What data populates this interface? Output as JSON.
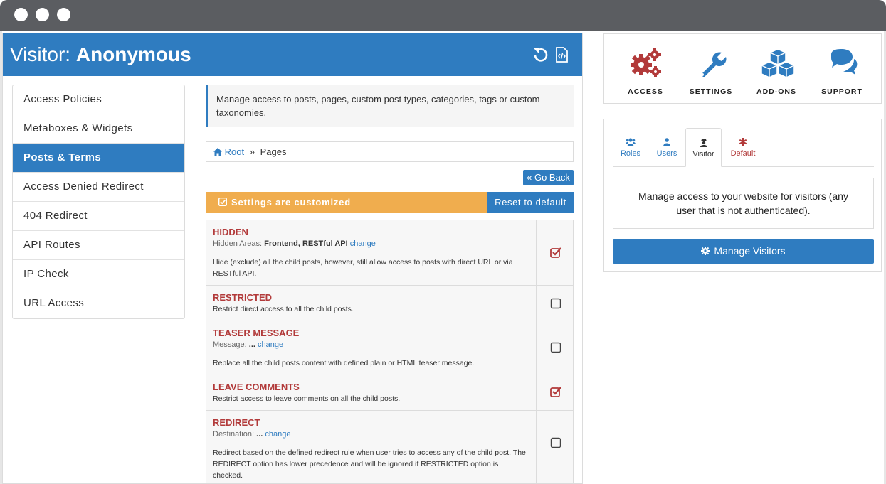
{
  "header": {
    "prefix": "Visitor:",
    "name": "Anonymous"
  },
  "nav": {
    "items": [
      {
        "label": "Access Policies"
      },
      {
        "label": "Metaboxes & Widgets"
      },
      {
        "label": "Posts & Terms",
        "active": true
      },
      {
        "label": "Access Denied Redirect"
      },
      {
        "label": "404 Redirect"
      },
      {
        "label": "API Routes"
      },
      {
        "label": "IP Check"
      },
      {
        "label": "URL Access"
      }
    ]
  },
  "content": {
    "info": "Manage access to posts, pages, custom post types, categories, tags or custom taxonomies.",
    "breadcrumb": {
      "root": "Root",
      "separator": "»",
      "current": "Pages"
    },
    "go_back": "« Go Back",
    "status": "Settings are customized",
    "reset": "Reset to default",
    "options": [
      {
        "title": "HIDDEN",
        "meta_label": "Hidden Areas:",
        "meta_value": "Frontend, RESTful API",
        "change": "change",
        "desc": "Hide (exclude) all the child posts, however, still allow access to posts with direct URL or via RESTful API.",
        "checked": true
      },
      {
        "title": "RESTRICTED",
        "desc": "Restrict direct access to all the child posts.",
        "checked": false
      },
      {
        "title": "TEASER MESSAGE",
        "meta_label": "Message:",
        "meta_value": "...",
        "change": "change",
        "desc": "Replace all the child posts content with defined plain or HTML teaser message.",
        "checked": false
      },
      {
        "title": "LEAVE COMMENTS",
        "desc": "Restrict access to leave comments on all the child posts.",
        "checked": true
      },
      {
        "title": "REDIRECT",
        "meta_label": "Destination:",
        "meta_value": "...",
        "change": "change",
        "desc": "Redirect based on the defined redirect rule when user tries to access any of the child post. The REDIRECT option has lower precedence and will be ignored if RESTRICTED option is checked.",
        "checked": false
      }
    ]
  },
  "tools": {
    "items": [
      {
        "label": "ACCESS",
        "icon": "gears-icon",
        "color": "#b23a3a"
      },
      {
        "label": "SETTINGS",
        "icon": "wrench-icon",
        "color": "#2f7cc0"
      },
      {
        "label": "ADD-ONS",
        "icon": "cubes-icon",
        "color": "#2f7cc0"
      },
      {
        "label": "SUPPORT",
        "icon": "comments-icon",
        "color": "#2f7cc0"
      }
    ]
  },
  "subjects": {
    "tabs": [
      {
        "label": "Roles",
        "icon": "users-icon"
      },
      {
        "label": "Users",
        "icon": "user-icon"
      },
      {
        "label": "Visitor",
        "icon": "user-secret-icon",
        "active": true
      },
      {
        "label": "Default",
        "icon": "asterisk-icon"
      }
    ],
    "visitor_text": "Manage access to your website for visitors (any user that is not authenticated).",
    "manage_button": "Manage Visitors"
  },
  "colors": {
    "primary": "#2f7cc0",
    "warning": "#f0ad4e",
    "danger": "#b23a3a"
  }
}
